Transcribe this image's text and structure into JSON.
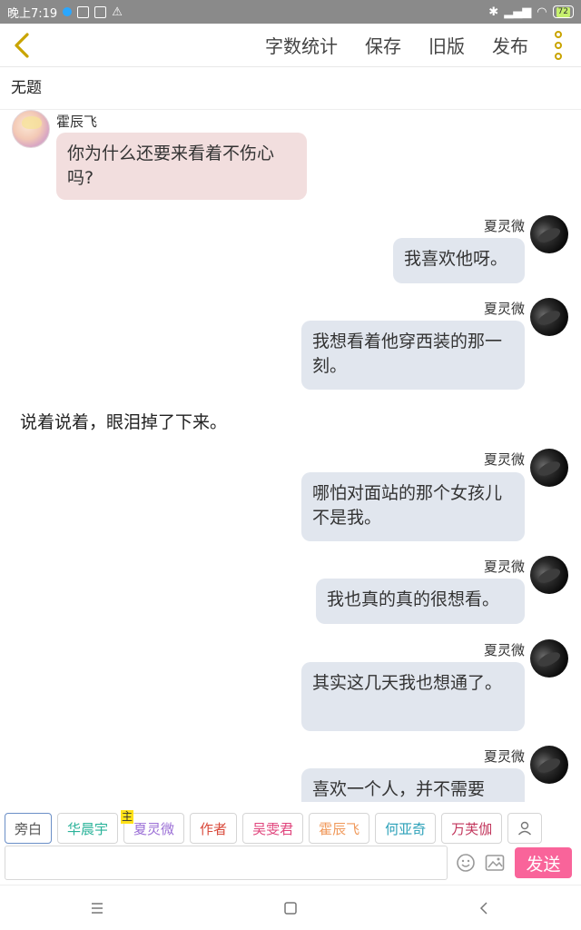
{
  "status": {
    "time": "晚上7:19",
    "battery": "72"
  },
  "toolbar": {
    "items": [
      "字数统计",
      "保存",
      "旧版",
      "发布"
    ]
  },
  "title": "无题",
  "messages": [
    {
      "side": "left",
      "name": "霍辰飞",
      "text": "你为什么还要来看着不伤心吗?"
    },
    {
      "side": "right",
      "name": "夏灵微",
      "text": "我喜欢他呀。"
    },
    {
      "side": "right",
      "name": "夏灵微",
      "text": "我想看着他穿西装的那一刻。"
    },
    {
      "side": "narration",
      "text": "说着说着，眼泪掉了下来。"
    },
    {
      "side": "right",
      "name": "夏灵微",
      "text": "哪怕对面站的那个女孩儿不是我。"
    },
    {
      "side": "right",
      "name": "夏灵微",
      "text": "我也真的真的很想看。"
    },
    {
      "side": "right",
      "name": "夏灵微",
      "text": "其实这几天我也想通了。"
    },
    {
      "side": "right",
      "name": "夏灵微",
      "text": "喜欢一个人，并不需要"
    }
  ],
  "characters": [
    {
      "name": "旁白",
      "color": "#555555",
      "active": true,
      "main": false
    },
    {
      "name": "华晨宇",
      "color": "#2bb39a",
      "active": false,
      "main": false
    },
    {
      "name": "夏灵微",
      "color": "#9b6fd6",
      "active": false,
      "main": true
    },
    {
      "name": "作者",
      "color": "#d94a3b",
      "active": false,
      "main": false
    },
    {
      "name": "吴雯君",
      "color": "#e0447c",
      "active": false,
      "main": false
    },
    {
      "name": "霍辰飞",
      "color": "#f09a5c",
      "active": false,
      "main": false
    },
    {
      "name": "何亚奇",
      "color": "#2aa0b8",
      "active": false,
      "main": false
    },
    {
      "name": "万芙伽",
      "color": "#c2365c",
      "active": false,
      "main": false
    }
  ],
  "main_tag": "主",
  "input": {
    "placeholder": "",
    "send_label": "发送"
  }
}
